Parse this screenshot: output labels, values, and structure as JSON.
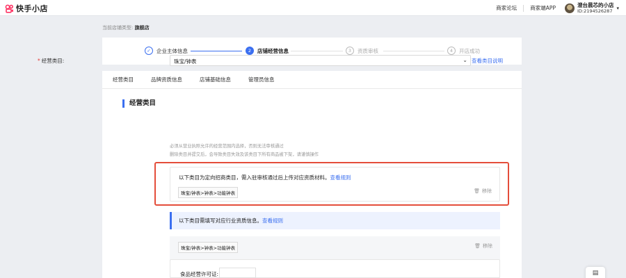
{
  "brand": {
    "name": "快手小店",
    "accent": "#fe3666"
  },
  "topbar": {
    "links": [
      "商家论坛",
      "商家端APP"
    ],
    "user_name": "澄台晨芯的小店",
    "user_id": "ID:2194526287",
    "caret": "▾"
  },
  "store_type": {
    "label": "当前店铺类型:",
    "value": "旗舰店"
  },
  "steps": [
    {
      "number": "✓",
      "label": "企业主体信息",
      "state": "done"
    },
    {
      "number": "2",
      "label": "店铺经营信息",
      "state": "active"
    },
    {
      "number": "3",
      "label": "资质审核",
      "state": "todo"
    },
    {
      "number": "4",
      "label": "开店成功",
      "state": "todo"
    }
  ],
  "tabs": [
    "经营类目",
    "品牌资质信息",
    "店铺基础信息",
    "管理员信息"
  ],
  "section": {
    "title": "经营类目"
  },
  "category_field": {
    "required_mark": "*",
    "label": "经营类目:",
    "value": "珠宝/钟表",
    "caret": "⌄",
    "link": "查看类目说明",
    "hint1": "必须从营业执照允许的经营范围内选择，否则无法审核通过",
    "hint2": "删除类目并提交后，会导致类目失效及该类目下所有商品被下架，请谨慎操作"
  },
  "box1": {
    "text": "以下类目为定向招商类目，需入驻审核通过后上传对应资质材料。",
    "link": "查看规则",
    "tag": "珠宝/钟表>钟表>功能钟表",
    "remove": "移除"
  },
  "notice": {
    "text": "以下类目需填写对应行业资质信息。",
    "link": "查看规则"
  },
  "box2": {
    "tag": "珠宝/钟表>钟表>功能钟表",
    "remove": "移除"
  },
  "food_license": {
    "label": "食品经营许可证:"
  },
  "colors": {
    "primary": "#3b6ff0",
    "highlight": "#e44d3a",
    "required": "#e53935"
  },
  "icons": [
    "kuaishou-logo-icon",
    "check-icon",
    "trash-icon",
    "chevron-down-icon",
    "feedback-icon"
  ]
}
